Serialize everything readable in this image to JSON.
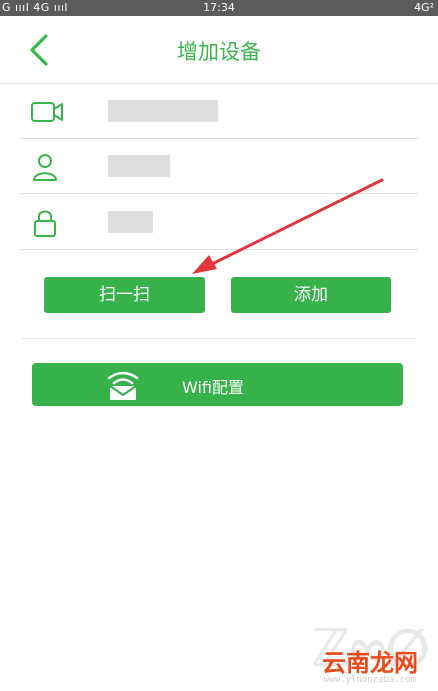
{
  "status_bar": {
    "left": "G ıııl 4G ıııl",
    "time": "17:34",
    "right": "4G²"
  },
  "header": {
    "back_icon": "back-arrow-icon",
    "title": "增加设备"
  },
  "form": {
    "device_id_icon": "video-camera-icon",
    "device_id_value": "██████████",
    "username_icon": "user-icon",
    "username_value": "████",
    "password_icon": "lock-icon",
    "password_value": "███"
  },
  "actions": {
    "scan_label": "扫一扫",
    "add_label": "添加"
  },
  "wifi": {
    "icon": "wifi-envelope-icon",
    "label": "Wifi配置"
  },
  "watermark": {
    "brand": "云南龙网",
    "url": "www.ylnanzaba.com"
  },
  "colors": {
    "accent": "#37b24a",
    "annotation_arrow": "#e0363c"
  }
}
